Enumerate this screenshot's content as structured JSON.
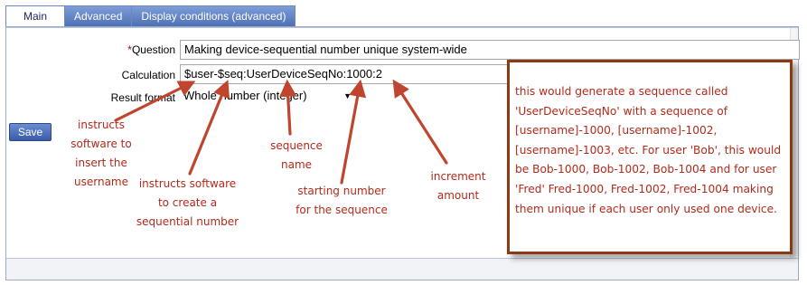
{
  "tabs": [
    {
      "label": "Main",
      "active": true
    },
    {
      "label": "Advanced",
      "active": false
    },
    {
      "label": "Display conditions (advanced)",
      "active": false
    }
  ],
  "form": {
    "question_label": "Question",
    "required_mark": "*",
    "question_value": "Making device-sequential number unique system-wide",
    "calculation_label": "Calculation",
    "calculation_value": "$user-$seq:UserDeviceSeqNo:1000:2",
    "result_format_label": "Result format",
    "result_format_value": "Whole number (integer)"
  },
  "save_label": "Save",
  "annotations": {
    "username": [
      "instructs",
      "software to",
      "insert the",
      "username"
    ],
    "sequential": [
      "instructs software",
      "to create a",
      "sequential number"
    ],
    "name": [
      "sequence",
      "name"
    ],
    "start": [
      "starting number",
      "for the sequence"
    ],
    "increment": [
      "increment",
      "amount"
    ]
  },
  "callout_text": "this would generate a sequence called 'UserDeviceSeqNo' with a sequence of [username]-1000, [username]-1002, [username]-1003, etc.  For user 'Bob', this would be Bob-1000, Bob-1002, Bob-1004 and for user 'Fred' Fred-1000, Fred-1002, Fred-1004 making them unique if each user only used one device.",
  "colors": {
    "annotation": "#b22a1a",
    "arrow": "#c0452e",
    "callout_border": "#8b3a14",
    "tab_active_text": "#1a2a60",
    "tab_inactive_bg": "#5a7cc0"
  }
}
